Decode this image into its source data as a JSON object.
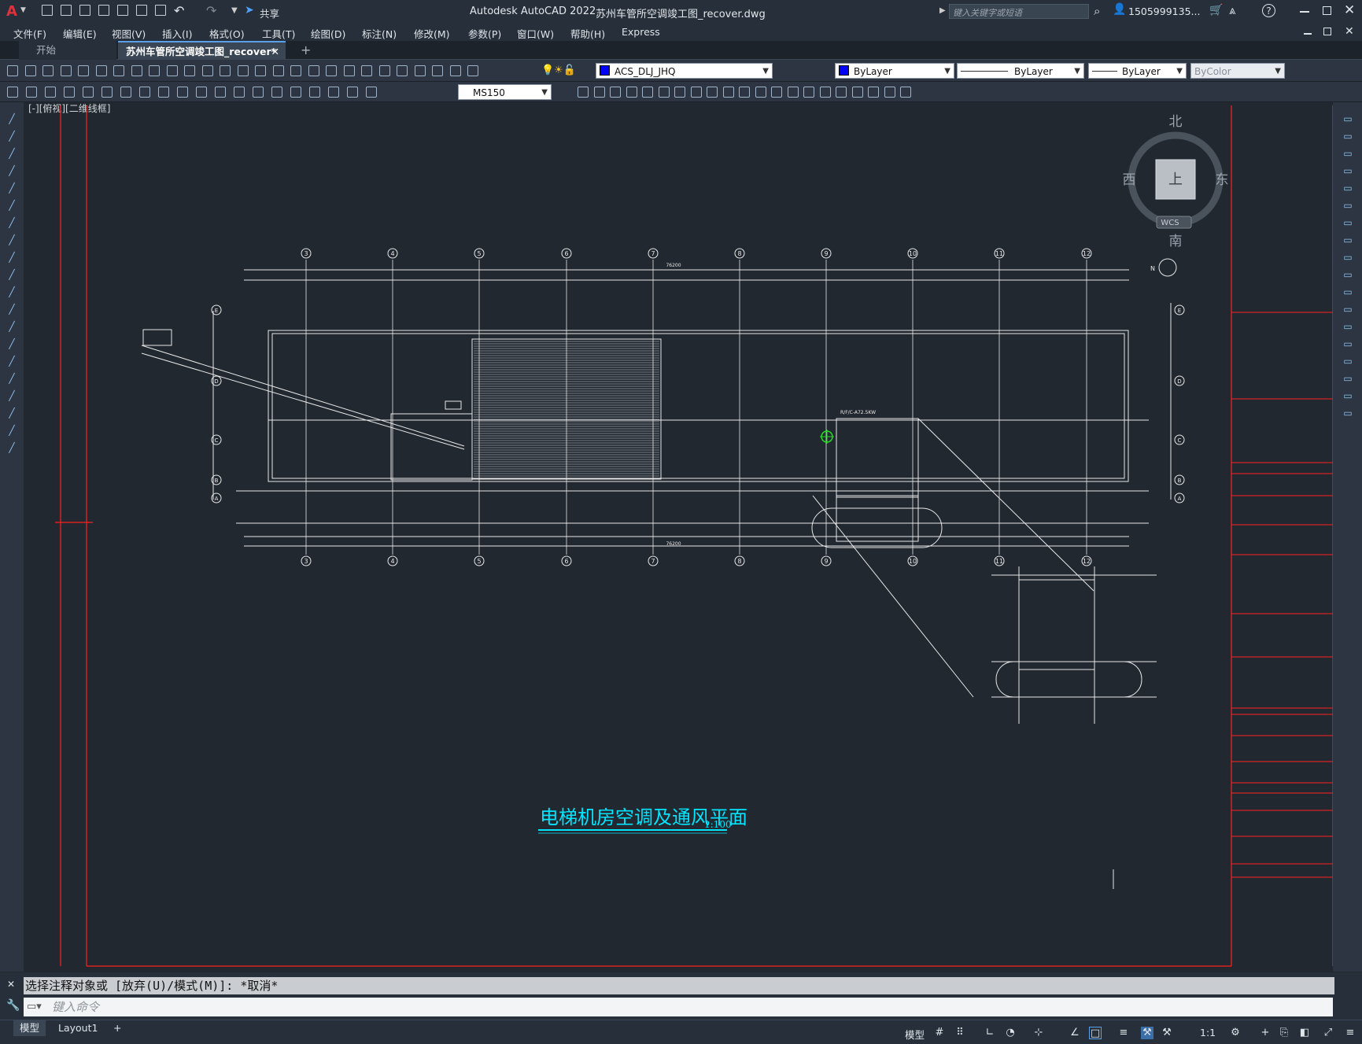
{
  "titlebar": {
    "app_title": "Autodesk AutoCAD 2022",
    "file_title": "苏州车管所空调竣工图_recover.dwg",
    "share_label": "共享",
    "search_placeholder": "键入关键字或短语",
    "user": "1505999135...",
    "help": "?"
  },
  "menu": [
    "文件(F)",
    "编辑(E)",
    "视图(V)",
    "插入(I)",
    "格式(O)",
    "工具(T)",
    "绘图(D)",
    "标注(N)",
    "修改(M)",
    "参数(P)",
    "窗口(W)",
    "帮助(H)",
    "Express"
  ],
  "tabs": {
    "start": "开始",
    "doc": "苏州车管所空调竣工图_recover*",
    "add": "+"
  },
  "toolbar": {
    "layer": "ACS_DLJ_JHQ",
    "color": "ByLayer",
    "linetype": "ByLayer",
    "lineweight": "ByLayer",
    "plotstyle": "ByColor",
    "dimstyle": "MS150",
    "layer_color": "#0000ff"
  },
  "viewport": {
    "label": "[-][俯视][二维线框]"
  },
  "viewcube": {
    "north": "北",
    "south": "南",
    "east": "东",
    "west": "西",
    "top": "上",
    "wcs": "WCS",
    "nav": "N"
  },
  "drawing": {
    "title": "电梯机房空调及通风平面",
    "scale": "1:100",
    "axes_top": [
      "3",
      "4",
      "5",
      "6",
      "7",
      "8",
      "9",
      "10",
      "11",
      "12"
    ],
    "total_dim": "76200",
    "row_axes": [
      "E",
      "D",
      "C",
      "B",
      "A"
    ],
    "annot_1": "R/F/C-A72.5KW"
  },
  "command": {
    "history": "选择注释对象或 [放弃(U)/模式(M)]: *取消*",
    "placeholder": "键入命令"
  },
  "status": {
    "model_tab": "模型",
    "layout_tab": "Layout1",
    "add": "+",
    "model_label": "模型",
    "scale": "1:1"
  },
  "colors": {
    "accent_cyan": "#00e5ff",
    "frame_red": "#ff2020",
    "dwg_white": "#e8e8e8"
  }
}
